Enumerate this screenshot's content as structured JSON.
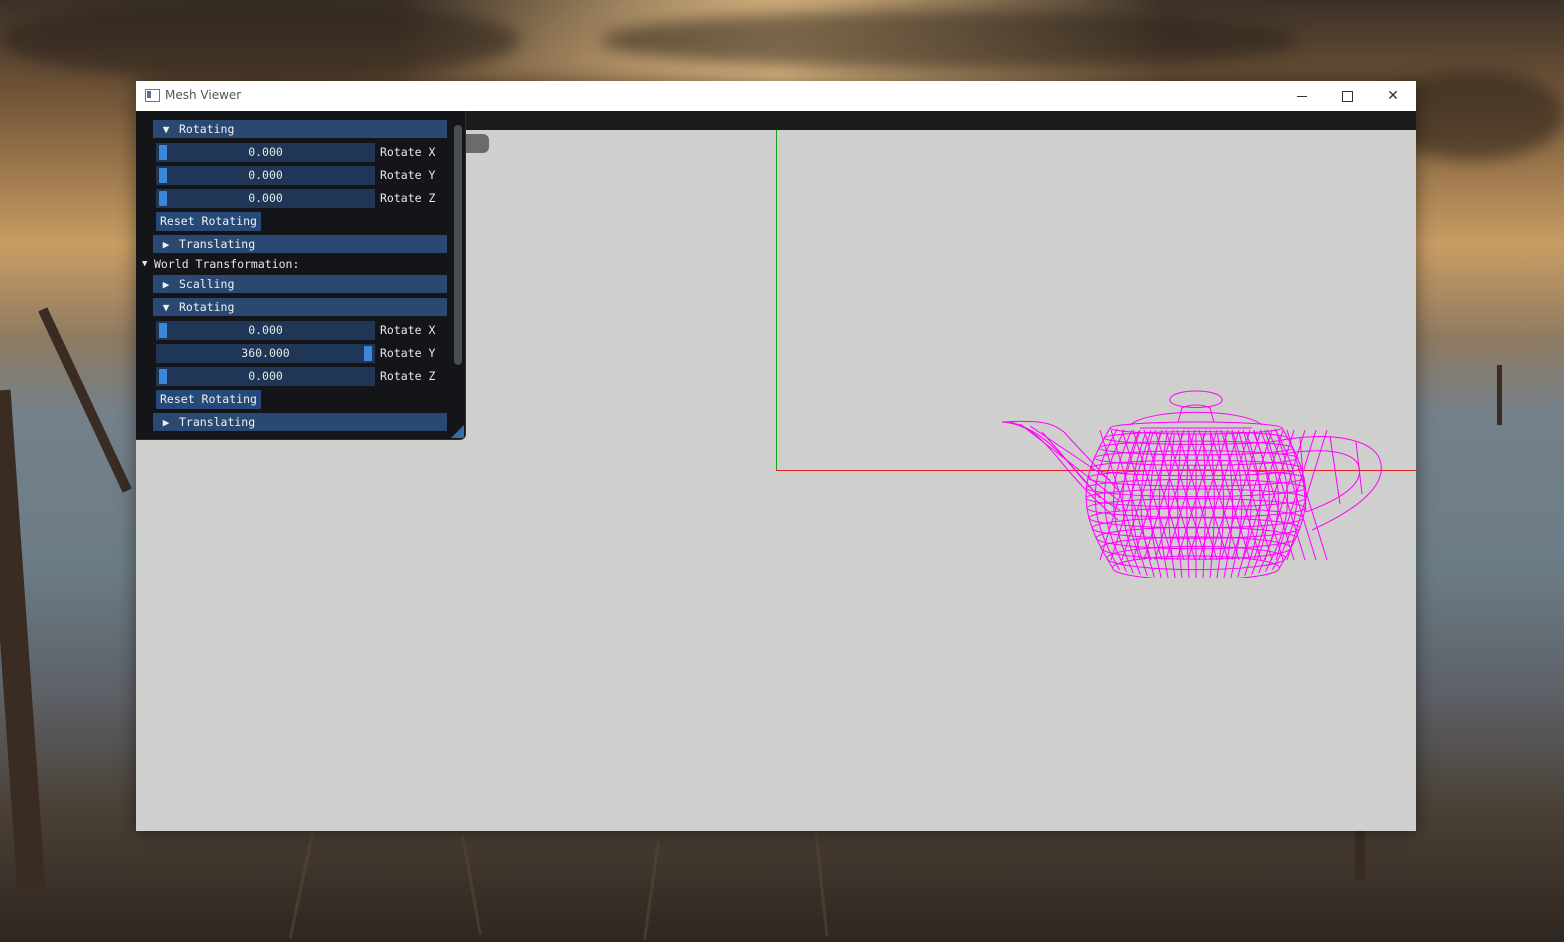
{
  "window": {
    "title": "Mesh Viewer"
  },
  "panel": {
    "model_rotating": {
      "header": "Rotating",
      "sliders": [
        {
          "value": "0.000",
          "label": "Rotate X",
          "fraction": 0
        },
        {
          "value": "0.000",
          "label": "Rotate Y",
          "fraction": 0
        },
        {
          "value": "0.000",
          "label": "Rotate Z",
          "fraction": 0
        }
      ],
      "reset_label": "Reset Rotating"
    },
    "model_translating": "Translating",
    "world_label": "World Transformation:",
    "world_scalling": "Scalling",
    "world_rotating": {
      "header": "Rotating",
      "sliders": [
        {
          "value": "0.000",
          "label": "Rotate X",
          "fraction": 0
        },
        {
          "value": "360.000",
          "label": "Rotate Y",
          "fraction": 1
        },
        {
          "value": "0.000",
          "label": "Rotate Z",
          "fraction": 0
        }
      ],
      "reset_label": "Reset Rotating"
    },
    "world_translating": "Translating"
  },
  "colors": {
    "mesh": "#ff00ff",
    "axis_x": "#dd2222",
    "axis_y": "#18a018",
    "viewport": "#cfcfcd"
  },
  "icons": {
    "expanded": "▼",
    "collapsed": "▶"
  }
}
